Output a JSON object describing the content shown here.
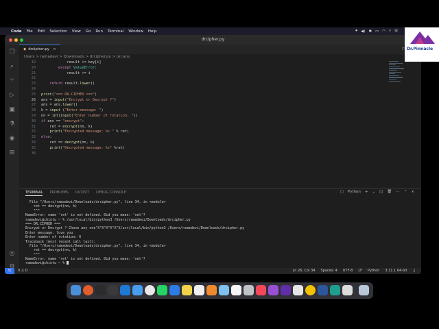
{
  "menubar": {
    "apple_icon": "apple-icon",
    "items": [
      "Code",
      "File",
      "Edit",
      "Selection",
      "View",
      "Go",
      "Run",
      "Terminal",
      "Window",
      "Help"
    ]
  },
  "window": {
    "title": "drcipher.py"
  },
  "tabs": [
    {
      "label": "drcipher.py",
      "active": true
    }
  ],
  "breadcrumb": "Users > ramadevi > Downloads > drcipher.py > [e] ans",
  "editor": {
    "current_line": 26,
    "lines": [
      {
        "n": "19",
        "text": "            result += key[i]"
      },
      {
        "n": "20",
        "text": "        except ValueError:"
      },
      {
        "n": "21",
        "text": "            result += i"
      },
      {
        "n": "22",
        "text": ""
      },
      {
        "n": "23",
        "text": "    return result.lower()"
      },
      {
        "n": "24",
        "text": ""
      },
      {
        "n": "25",
        "text": "print(\"=== DR.CIPHER ===\")"
      },
      {
        "n": "26",
        "text": "ans = input(\"Encrypt or Decrypt ?\")"
      },
      {
        "n": "27",
        "text": "ans = ans.lower()"
      },
      {
        "n": "28",
        "text": "k = input (\"Enter message: \")"
      },
      {
        "n": "29",
        "text": "nn = int(input(\"Enter number of rotation: \"))"
      },
      {
        "n": "30",
        "text": "if ans == \"encrypt\":"
      },
      {
        "n": "31",
        "text": "    ret = encrypt(nn, k)"
      },
      {
        "n": "32",
        "text": "    print(\"Encrypted message: %s \" % ret)"
      },
      {
        "n": "33",
        "text": "else:"
      },
      {
        "n": "34",
        "text": "    ret == decrypt(nn, k)"
      },
      {
        "n": "35",
        "text": "    print(\"Decrypted message: %s\" %ret)"
      },
      {
        "n": "36",
        "text": ""
      }
    ]
  },
  "panel": {
    "tabs": [
      "TERMINAL",
      "PROBLEMS",
      "OUTPUT",
      "DEBUG CONSOLE"
    ],
    "active_tab": "TERMINAL",
    "shell_label": "Python",
    "terminal_lines": [
      "  File \"/Users/ramadevi/Downloads/drcipher.py\", line 34, in <module>",
      "    ret == decrypt(nn, k)",
      "    ^^^",
      "NameError: name 'ret' is not defined. Did you mean: 'set'?",
      "ramadevi@chintu ~ % /usr/local/bin/python3 /Users/ramadevi/Downloads/drcipher.py",
      "=== DR.CIPHER ===",
      "Encrypt or Decrypt ? Chose any one\"X\"X\"X\"X\"X\"X/usr/local/bin/python3 /Users/ramadevi/Downloads/drcipher.py",
      "Enter message: love you",
      "Enter number of rotation: 6",
      "Traceback (most recent call last):",
      "  File \"/Users/ramadevi/Downloads/drcipher.py\", line 34, in <module>",
      "    ret == decrypt(nn, k)",
      "    ^^^",
      "NameError: name 'ret' is not defined. Did you mean: 'set'?",
      "ramadevi@chintu ~ % "
    ]
  },
  "statusbar": {
    "problems": "0 ⚠ 0",
    "position": "Ln 26, Col 34",
    "spaces": "Spaces: 4",
    "encoding": "UTF-8",
    "eol": "LF",
    "language": "Python",
    "interpreter": "3.11.1 64-bit"
  },
  "badge": {
    "name": "Dr.Pinnacle"
  }
}
